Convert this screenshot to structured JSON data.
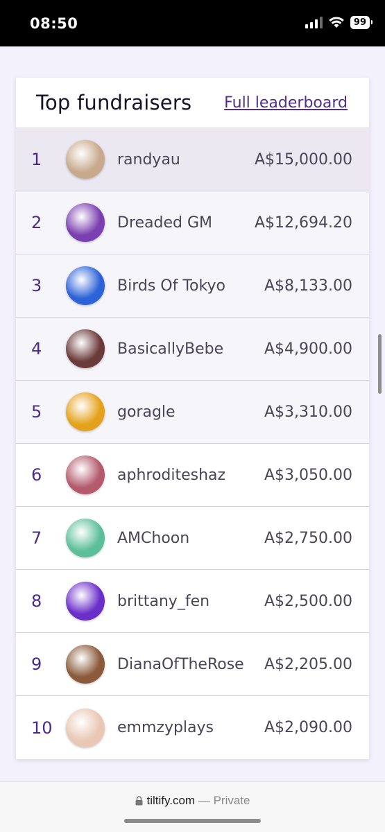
{
  "status_bar": {
    "time": "08:50",
    "battery": "99"
  },
  "card": {
    "title": "Top fundraisers",
    "link": "Full leaderboard",
    "rows": [
      {
        "rank": "1",
        "name": "randyau",
        "amount": "A$15,000.00",
        "avatar_color": "#c8a98c"
      },
      {
        "rank": "2",
        "name": "Dreaded GM",
        "amount": "A$12,694.20",
        "avatar_color": "#7a3fb0"
      },
      {
        "rank": "3",
        "name": "Birds Of Tokyo",
        "amount": "A$8,133.00",
        "avatar_color": "#2d63d8"
      },
      {
        "rank": "4",
        "name": "BasicallyBebe",
        "amount": "A$4,900.00",
        "avatar_color": "#6b3a3a"
      },
      {
        "rank": "5",
        "name": "goragle",
        "amount": "A$3,310.00",
        "avatar_color": "#e4a21c"
      },
      {
        "rank": "6",
        "name": "aphroditeshaz",
        "amount": "A$3,050.00",
        "avatar_color": "#b45a6c"
      },
      {
        "rank": "7",
        "name": "AMChoon",
        "amount": "A$2,750.00",
        "avatar_color": "#5dbf9a"
      },
      {
        "rank": "8",
        "name": "brittany_fen",
        "amount": "A$2,500.00",
        "avatar_color": "#6a2fc9"
      },
      {
        "rank": "9",
        "name": "DianaOfTheRose",
        "amount": "A$2,205.00",
        "avatar_color": "#8a5a3a"
      },
      {
        "rank": "10",
        "name": "emmzyplays",
        "amount": "A$2,090.00",
        "avatar_color": "#e9c7b4"
      }
    ]
  },
  "browser": {
    "domain": "tiltify.com",
    "separator": "—",
    "mode": "Private"
  },
  "colors": {
    "accent": "#4e2e8f",
    "rank": "#4a2b8c",
    "background": "#f3f1fb"
  }
}
